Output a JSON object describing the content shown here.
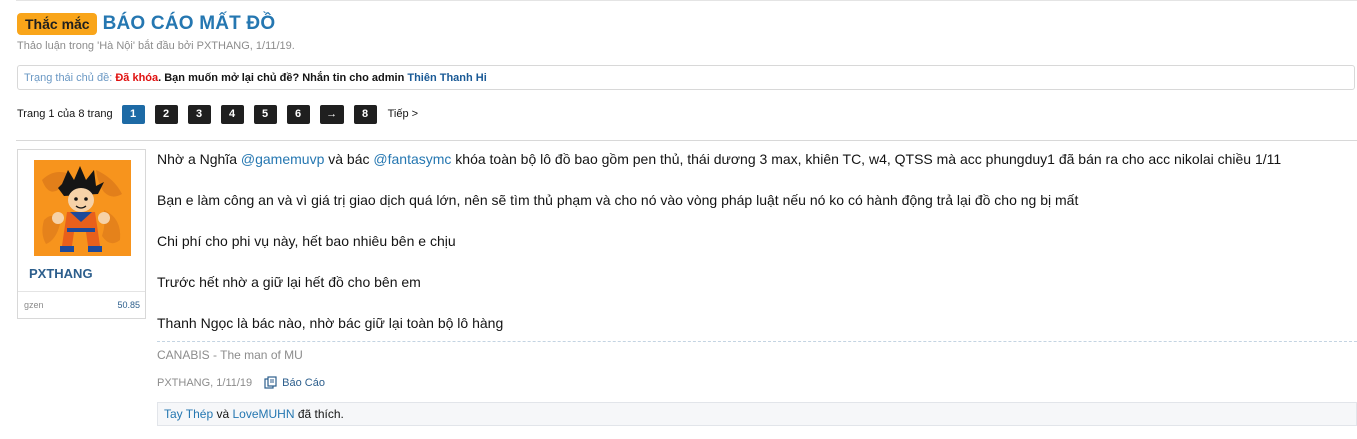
{
  "thread": {
    "prefix": "Thắc mắc",
    "title": "BÁO CÁO MẤT ĐỒ",
    "meta_prefix": "Thảo luận trong ",
    "forum": "'Hà Nội'",
    "meta_started_by": " bắt đầu bởi ",
    "author": "PXTHANG",
    "date": ", 1/11/19."
  },
  "status": {
    "label": "Trạng thái chủ đề:",
    "locked": "Đã khóa",
    "message": ". Bạn muốn mở lại chủ đề? Nhắn tin cho admin ",
    "admin": "Thiên Thanh Hi"
  },
  "pager": {
    "label": "Trang 1 của 8 trang",
    "pages": [
      "1",
      "2",
      "3",
      "4",
      "5",
      "6",
      "→",
      "8"
    ],
    "next": "Tiếp >"
  },
  "user": {
    "name": "PXTHANG",
    "stat_label": "gzen",
    "stat_value": "50.85"
  },
  "post": {
    "p1_a": "Nhờ a Nghĩa ",
    "p1_mention1": "@gamemuvp",
    "p1_b": " và bác ",
    "p1_mention2": "@fantasymc",
    "p1_c": " khóa toàn bộ lô đồ bao gồm pen thủ, thái dương 3 max, khiên TC, w4, QTSS mà acc phungduy1 đã bán ra cho acc nikolai chiều 1/11",
    "p2": "Bạn e làm công an và vì giá trị giao dịch quá lớn, nên sẽ tìm thủ phạm và cho nó vào vòng pháp luật nếu nó ko có hành động trả lại đồ cho ng bị mất",
    "p3": "Chi phí cho phi vụ này, hết bao nhiêu bên e chịu",
    "p4": "Trước hết nhờ a giữ lại hết đồ cho bên em",
    "p5": "Thanh Ngọc là bác nào, nhờ bác giữ lại toàn bộ lô hàng",
    "signature": "CANABIS - The man of MU",
    "meta": "PXTHANG, 1/11/19",
    "report": "Báo Cáo"
  },
  "likes": {
    "liker1": "Tay Thép",
    "connector": " và ",
    "liker2": "LoveMUHN",
    "suffix": " đã thích."
  },
  "colors": {
    "accent": "#2577b1",
    "prefix_bg": "#f9a51a",
    "locked": "#e0100f",
    "page_current": "#1d6aa5",
    "page_bg": "#1f1f1f",
    "avatar_bg": "#f7941d"
  }
}
